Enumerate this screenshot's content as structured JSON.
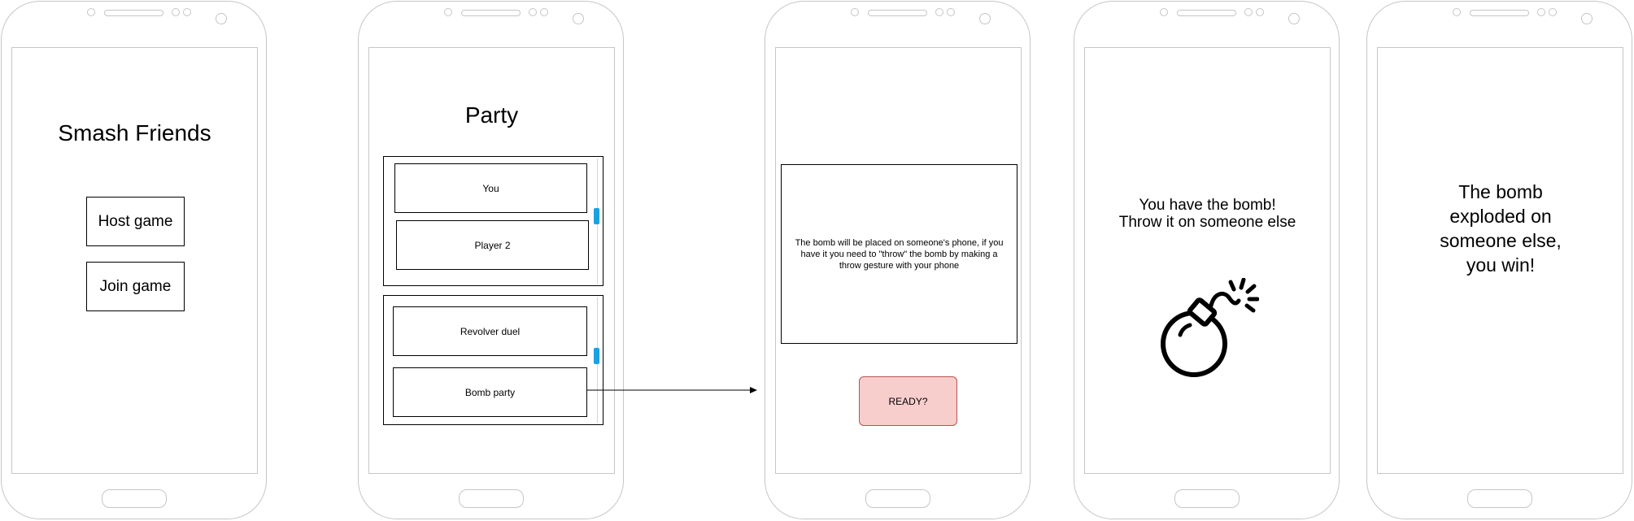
{
  "screen1": {
    "title": "Smash Friends",
    "host_button": "Host game",
    "join_button": "Join game"
  },
  "screen2": {
    "title": "Party",
    "players": [
      "You",
      "Player 2"
    ],
    "games": [
      "Revolver duel",
      "Bomb party"
    ]
  },
  "screen3": {
    "instructions": "The bomb will be placed on someone's phone, if you have it you need to \"throw\" the bomb by making a throw gesture with your phone",
    "ready_button": "READY?"
  },
  "screen4": {
    "message_line1": "You have the bomb!",
    "message_line2": "Throw it on someone else",
    "icon": "bomb-icon"
  },
  "screen5": {
    "message": "The bomb exploded on someone else, you win!"
  },
  "colors": {
    "outline": "#c6c6c6",
    "scroll_accent": "#1ba1e2",
    "ready_fill": "#f8cecc",
    "ready_border": "#b85450"
  }
}
